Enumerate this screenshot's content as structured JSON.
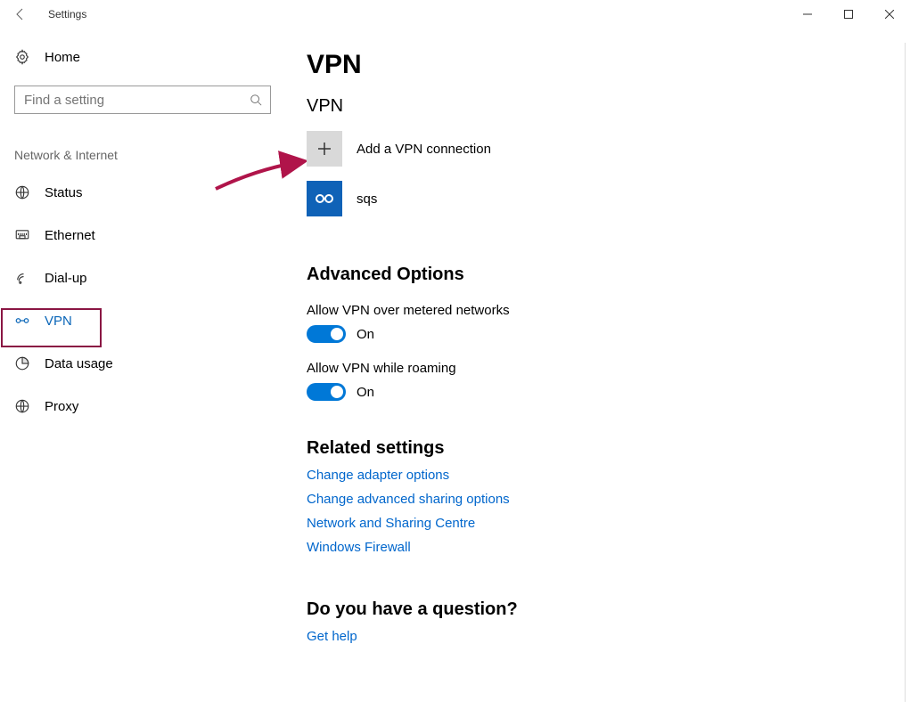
{
  "window": {
    "title": "Settings"
  },
  "sidebar": {
    "home_label": "Home",
    "search_placeholder": "Find a setting",
    "group_label": "Network & Internet",
    "items": [
      {
        "label": "Status"
      },
      {
        "label": "Ethernet"
      },
      {
        "label": "Dial-up"
      },
      {
        "label": "VPN"
      },
      {
        "label": "Data usage"
      },
      {
        "label": "Proxy"
      }
    ]
  },
  "main": {
    "page_title": "VPN",
    "vpn_section_title": "VPN",
    "add_vpn_label": "Add a VPN connection",
    "connections": [
      {
        "name": "sqs"
      }
    ],
    "advanced_title": "Advanced Options",
    "options": [
      {
        "label": "Allow VPN over metered networks",
        "on": true,
        "state": "On"
      },
      {
        "label": "Allow VPN while roaming",
        "on": true,
        "state": "On"
      }
    ],
    "related_title": "Related settings",
    "related_links": [
      "Change adapter options",
      "Change advanced sharing options",
      "Network and Sharing Centre",
      "Windows Firewall"
    ],
    "question_title": "Do you have a question?",
    "help_link": "Get help"
  }
}
